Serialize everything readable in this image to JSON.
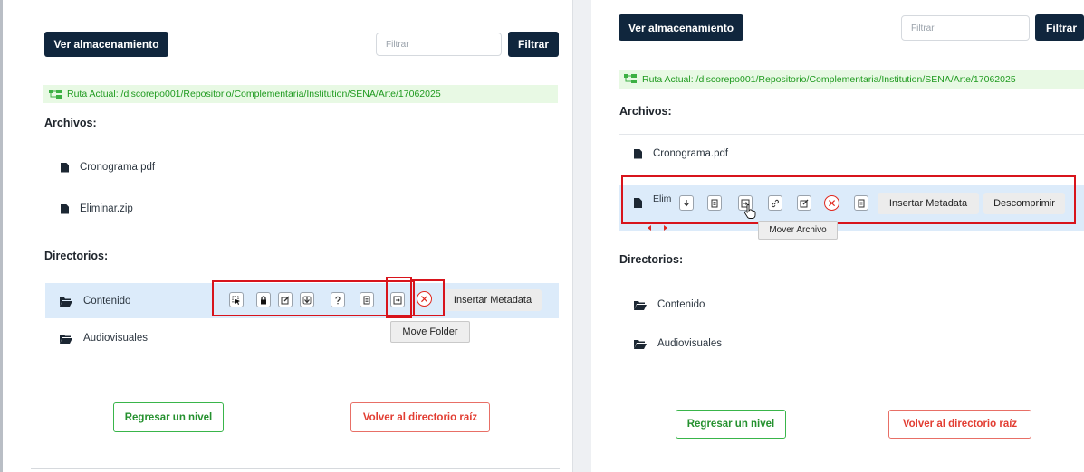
{
  "left": {
    "ver_almacenamiento": "Ver almacenamiento",
    "filter_placeholder": "Filtrar",
    "filter_button": "Filtrar",
    "path_text": "Ruta Actual: /discorepo001/Repositorio/Complementaria/Institution/SENA/Arte/17062025",
    "files_title": "Archivos:",
    "files": [
      "Cronograma.pdf",
      "Eliminar.zip"
    ],
    "dirs_title": "Directorios:",
    "dirs": [
      "Contenido",
      "Audiovisuales"
    ],
    "insert_metadata": "Insertar Metadata",
    "tooltip": "Move Folder",
    "back_button": "Regresar un nivel",
    "root_button": "Volver al directorio raíz"
  },
  "right": {
    "ver_almacenamiento": "Ver almacenamiento",
    "filter_placeholder": "Filtrar",
    "filter_button": "Filtrar",
    "path_text": "Ruta Actual: /discorepo001/Repositorio/Complementaria/Institution/SENA/Arte/17062025",
    "files_title": "Archivos:",
    "files": [
      "Cronograma.pdf",
      "Elim"
    ],
    "insert_metadata": "Insertar Metadata",
    "decompress": "Descomprimir",
    "tooltip": "Mover Archivo",
    "dirs_title": "Directorios:",
    "dirs": [
      "Contenido",
      "Audiovisuales"
    ],
    "back_button": "Regresar un nivel",
    "root_button": "Volver al directorio raíz"
  },
  "colors": {
    "dark_button": "#10263d",
    "path_bg": "#e8f9e4",
    "path_text": "#1f9a1f",
    "highlight_row": "#dcebfa",
    "annotation_red": "#d8141c",
    "delete_red": "#e0281f",
    "green_button": "#39b54a",
    "red_button": "#e86f66"
  }
}
